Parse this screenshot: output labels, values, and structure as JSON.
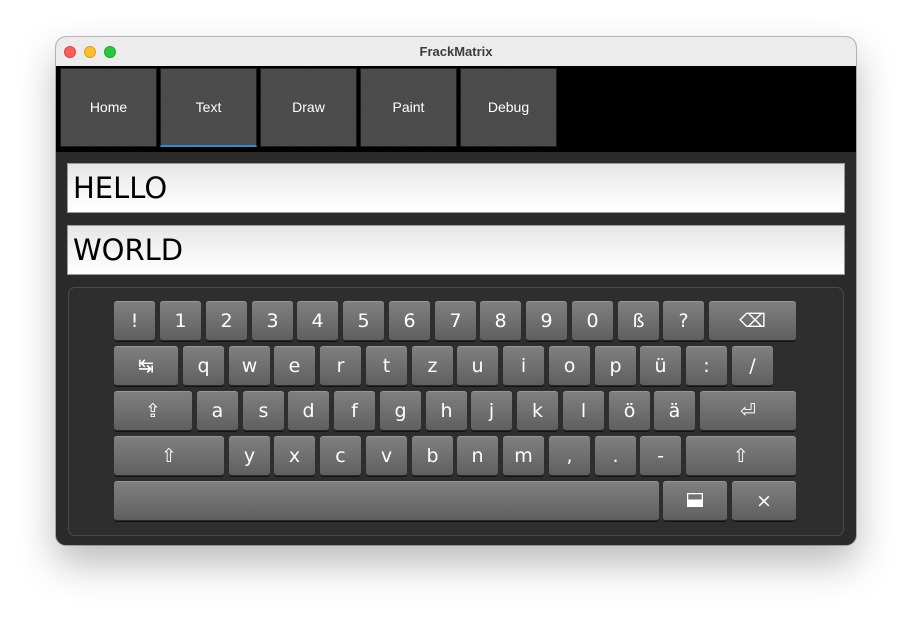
{
  "window": {
    "title": "FrackMatrix"
  },
  "tabs": [
    {
      "label": "Home"
    },
    {
      "label": "Text",
      "active": true
    },
    {
      "label": "Draw"
    },
    {
      "label": "Paint"
    },
    {
      "label": "Debug"
    }
  ],
  "fields": {
    "line1": "HELLO",
    "line2": "WORLD"
  },
  "keyboard": {
    "row1": [
      "!",
      "1",
      "2",
      "3",
      "4",
      "5",
      "6",
      "7",
      "8",
      "9",
      "0",
      "ß",
      "?"
    ],
    "backspace": "⌫",
    "tab": "↹",
    "row2": [
      "q",
      "w",
      "e",
      "r",
      "t",
      "z",
      "u",
      "i",
      "o",
      "p",
      "ü",
      ":",
      "/"
    ],
    "capslock": "⇪",
    "row3": [
      "a",
      "s",
      "d",
      "f",
      "g",
      "h",
      "j",
      "k",
      "l",
      "ö",
      "ä"
    ],
    "enter": "⏎",
    "shift": "⇧",
    "row4": [
      "y",
      "x",
      "c",
      "v",
      "b",
      "n",
      "m",
      ",",
      ".",
      "-"
    ],
    "hide": "▬",
    "close": "×"
  },
  "colors": {
    "accent": "#2a8fd6",
    "tab_bg": "#4b4b4b",
    "key": "#737373",
    "window_bg": "#2b2b2b"
  }
}
